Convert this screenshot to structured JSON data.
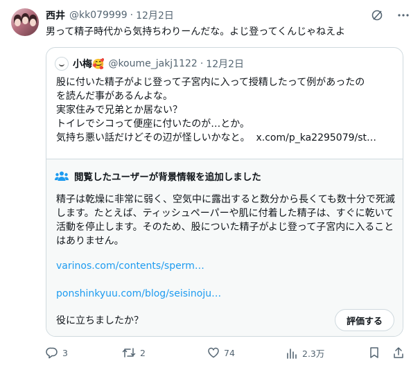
{
  "tweet": {
    "author_name": "西井",
    "handle": "@kk079999",
    "separator": "·",
    "date": "12月2日",
    "text": "男って精子時代から気持ちわりーんだな。よじ登ってくんじゃねえよ",
    "more_icon": "more-dots-icon",
    "grok_icon": "grok-slash-icon"
  },
  "quote": {
    "author_name": "小梅🥰",
    "handle": "@koume_jakj1122",
    "separator": "·",
    "date": "12月2日",
    "lines": [
      "股に付いた精子がよじ登って子宮内に入って授精したって例があったの",
      "を読んだ事があるんよな。",
      "実家住みで兄弟とか居ない？",
      "トイレでシコって便座に付いたのが…とか。",
      "気持ち悪い話だけどその辺が怪しいかなと。"
    ],
    "link": "x.com/p_ka2295079/st…"
  },
  "community_note": {
    "title": "閲覧したユーザーが背景情報を追加しました",
    "icon": "community-notes-icon",
    "body": "精子は乾燥に非常に弱く、空気中に露出すると数分から長くても数十分で死滅します。たとえば、ティッシュペーパーや肌に付着した精子は、すぐに乾いて活動を停止します。そのため、股についた精子がよじ登って子宮内に入ることはありません。",
    "links": [
      "varinos.com/contents/sperm…",
      "ponshinkyuu.com/blog/seisinoju…"
    ],
    "helpful_question": "役に立ちましたか？",
    "rate_button": "評価する"
  },
  "actions": {
    "replies": "3",
    "retweets": "2",
    "likes": "74",
    "views": "2.3万"
  },
  "colors": {
    "link": "#1d9bf0",
    "secondary_text": "#536471",
    "border": "#cfd9de",
    "note_background": "#f7f9f9"
  }
}
